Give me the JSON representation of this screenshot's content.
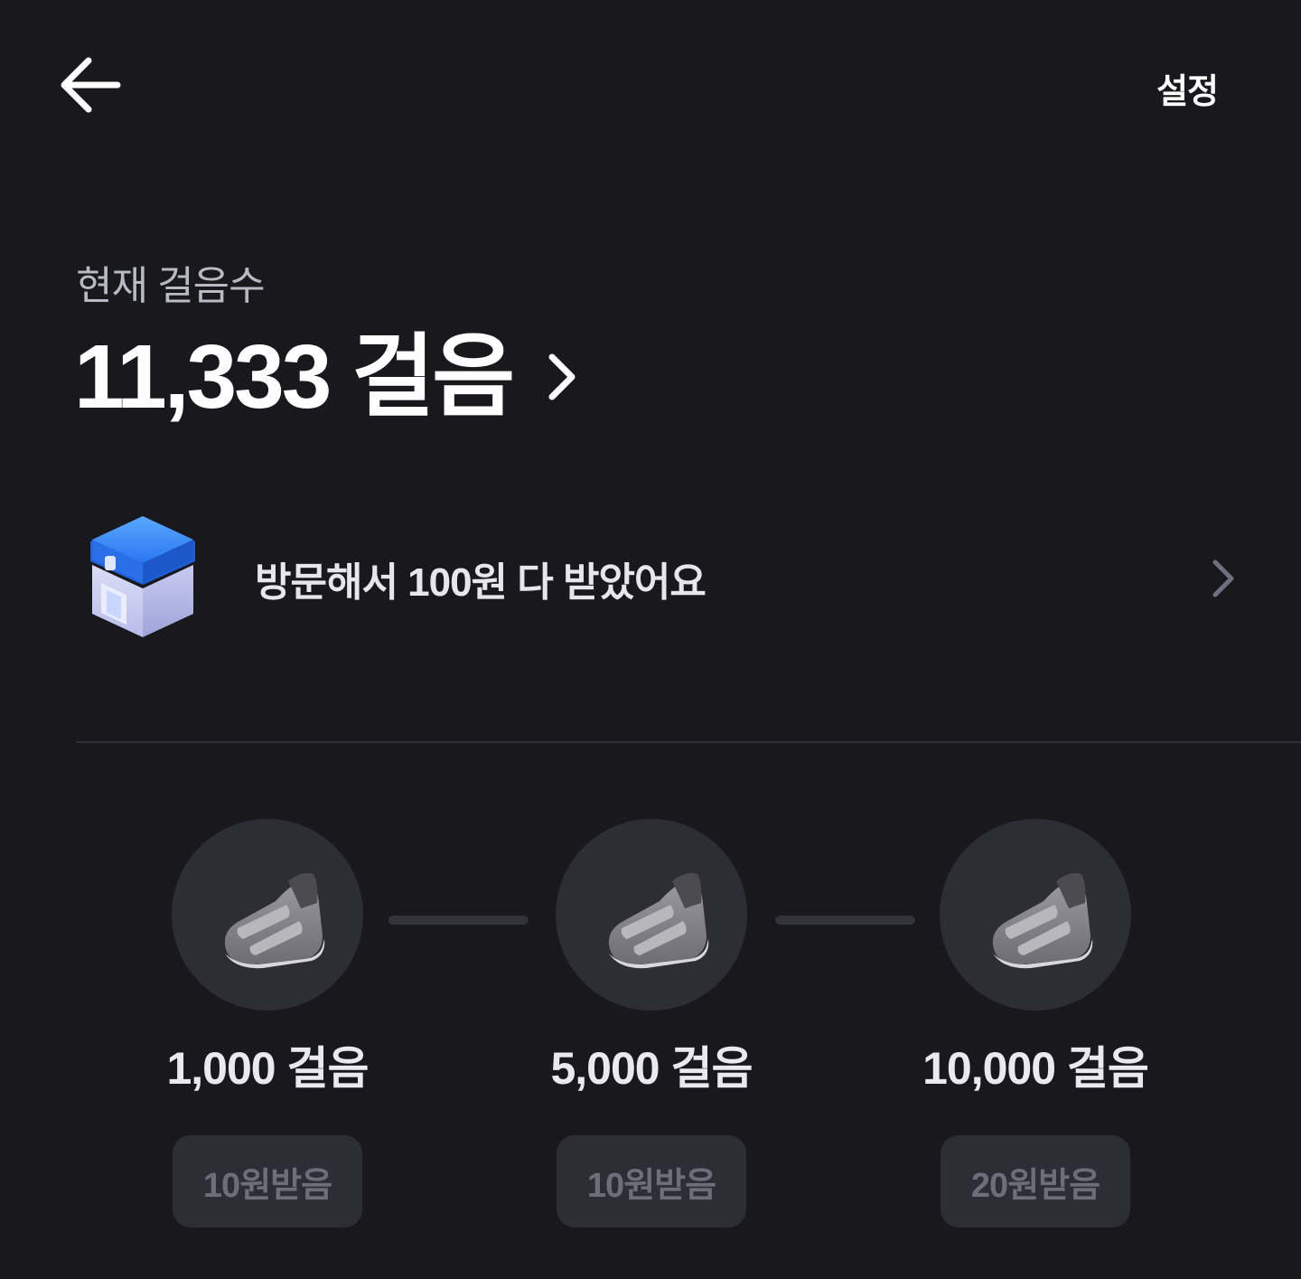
{
  "header": {
    "back_icon": "arrow-left-icon",
    "settings_label": "설정"
  },
  "summary": {
    "label": "현재 걸음수",
    "step_count": "11,333 걸음",
    "chevron_icon": "chevron-right-icon"
  },
  "visit": {
    "icon": "shop-icon",
    "text": "방문해서 100원 다 받았어요",
    "chevron_icon": "chevron-right-icon"
  },
  "milestones": [
    {
      "icon": "shoe-icon",
      "label": "1,000 걸음",
      "reward": "10원받음"
    },
    {
      "icon": "shoe-icon",
      "label": "5,000 걸음",
      "reward": "10원받음"
    },
    {
      "icon": "shoe-icon",
      "label": "10,000 걸음",
      "reward": "20원받음"
    }
  ],
  "colors": {
    "background": "#18181d",
    "text_primary": "#ffffff",
    "text_secondary": "#b8bac3",
    "surface": "#2c2d35",
    "reward_text_disabled": "#6c6e79",
    "accent_blue": "#2f7cf6"
  }
}
